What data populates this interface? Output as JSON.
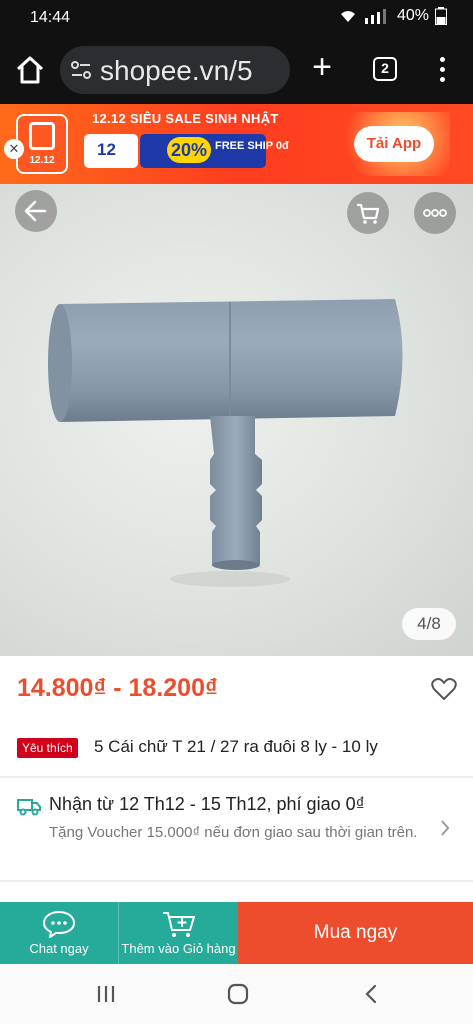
{
  "status_bar": {
    "time": "14:44",
    "battery": "40%"
  },
  "browser": {
    "url": "shopee.vn/5",
    "tab_count": "2"
  },
  "promo": {
    "logo_text": "12.12",
    "title": "12.12 SIÊU SALE SINH NHẬT",
    "card_big_1": "12",
    "card_big_2": "20%",
    "card_big_3": "FREE SHIP 0đ",
    "cta": "Tải App"
  },
  "product": {
    "image_counter": "4/8",
    "price": "14.800₫ - 18.200₫",
    "badge": "Yêu thích",
    "title": "5 Cái chữ T 21 / 27 ra đuôi 8 ly - 10 ly"
  },
  "shipping": {
    "title": "Nhận từ 12 Th12 - 15 Th12, phí giao 0₫",
    "subtitle": "Tặng Voucher 15.000₫ nếu đơn giao sau thời gian trên."
  },
  "actions": {
    "chat": "Chat ngay",
    "add_cart": "Thêm vào Giỏ hàng",
    "buy_now": "Mua ngay"
  },
  "colors": {
    "brand": "#ee4d2d",
    "teal": "#26aa99",
    "dark": "#111111"
  }
}
